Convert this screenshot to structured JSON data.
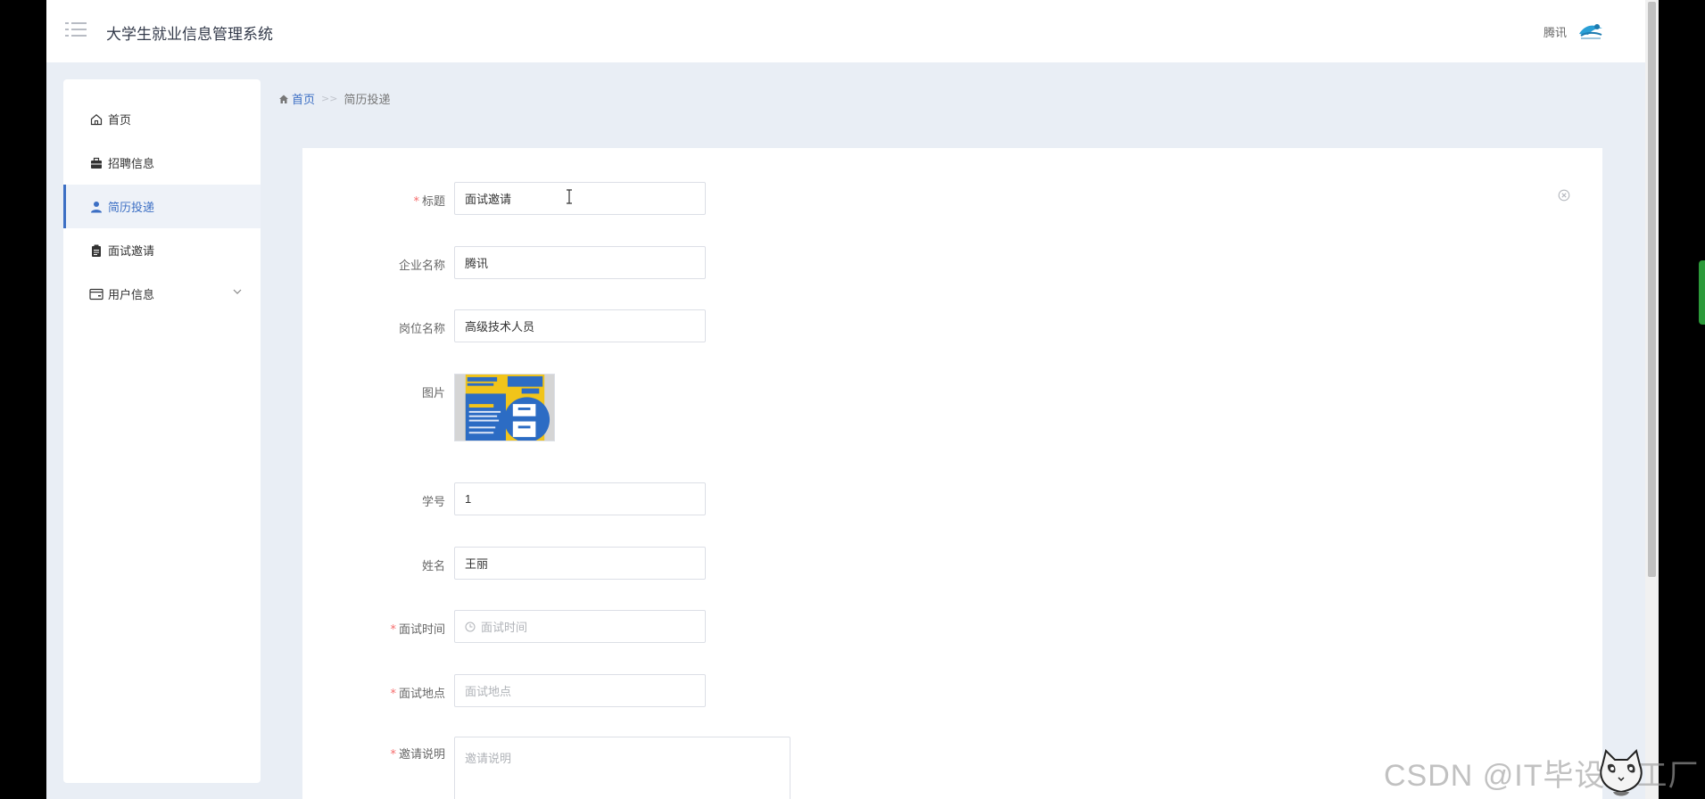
{
  "header": {
    "app_title": "大学生就业信息管理系统",
    "user_name": "腾讯"
  },
  "sidebar": {
    "items": [
      {
        "label": "首页",
        "icon": "home-icon"
      },
      {
        "label": "招聘信息",
        "icon": "briefcase-icon"
      },
      {
        "label": "简历投递",
        "icon": "user-icon",
        "active": true
      },
      {
        "label": "面试邀请",
        "icon": "clipboard-icon"
      },
      {
        "label": "用户信息",
        "icon": "card-icon",
        "expandable": true
      }
    ]
  },
  "breadcrumb": {
    "home": "首页",
    "separator": ">>",
    "current": "简历投递"
  },
  "form": {
    "title": {
      "label": "标题",
      "required": true,
      "value": "面试邀请"
    },
    "company": {
      "label": "企业名称",
      "value": "腾讯"
    },
    "position": {
      "label": "岗位名称",
      "value": "高级技术人员"
    },
    "image": {
      "label": "图片"
    },
    "student_id": {
      "label": "学号",
      "value": "1"
    },
    "name": {
      "label": "姓名",
      "value": "王丽"
    },
    "interview_time": {
      "label": "面试时间",
      "required": true,
      "placeholder": "面试时间"
    },
    "interview_place": {
      "label": "面试地点",
      "required": true,
      "placeholder": "面试地点"
    },
    "invite_note": {
      "label": "邀请说明",
      "required": true,
      "placeholder": "邀请说明"
    }
  },
  "watermark": "CSDN @IT毕设梦工厂",
  "colors": {
    "accent": "#3c6fc4",
    "required": "#f56c6c",
    "page_bg": "#e9eef5"
  }
}
